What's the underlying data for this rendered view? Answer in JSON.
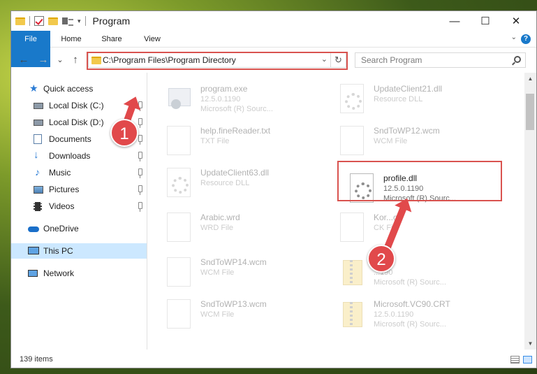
{
  "window": {
    "title": "Program",
    "controls": {
      "minimize": "—",
      "maximize": "☐",
      "close": "✕"
    }
  },
  "ribbon": {
    "tabs": [
      "File",
      "Home",
      "Share",
      "View"
    ],
    "help": "?",
    "toggle": "⌄"
  },
  "nav": {
    "back": "←",
    "forward": "→",
    "recent": "⌄",
    "up": "↑",
    "address": "C:\\Program Files\\Program Directory",
    "address_drop": "⌄",
    "refresh": "↻",
    "search_placeholder": "Search Program"
  },
  "sidebar": {
    "items": [
      {
        "label": "Quick access",
        "icon": "star-icon"
      },
      {
        "label": "Local Disk (C:)",
        "icon": "drive-icon"
      },
      {
        "label": "Local Disk (D:)",
        "icon": "drive-icon"
      },
      {
        "label": "Documents",
        "icon": "documents-icon"
      },
      {
        "label": "Downloads",
        "icon": "download-icon"
      },
      {
        "label": "Music",
        "icon": "music-icon"
      },
      {
        "label": "Pictures",
        "icon": "pictures-icon"
      },
      {
        "label": "Videos",
        "icon": "videos-icon"
      },
      {
        "label": "OneDrive",
        "icon": "cloud-icon"
      },
      {
        "label": "This PC",
        "icon": "computer-icon"
      },
      {
        "label": "Network",
        "icon": "network-icon"
      }
    ]
  },
  "files": [
    {
      "name": "program.exe",
      "line2": "12.5.0.1190",
      "line3": "Microsoft (R) Sourc...",
      "icon": "exe"
    },
    {
      "name": "UpdateClient21.dll",
      "line2": "Resource DLL",
      "line3": "",
      "icon": "gear"
    },
    {
      "name": "help.fineReader.txt",
      "line2": "TXT File",
      "line3": "",
      "icon": "doc"
    },
    {
      "name": "SndToWP12.wcm",
      "line2": "WCM File",
      "line3": "",
      "icon": "doc"
    },
    {
      "name": "UpdateClient63.dll",
      "line2": "Resource DLL",
      "line3": "",
      "icon": "gear"
    },
    {
      "name": "profile.dll",
      "line2": "12.5.0.1190",
      "line3": "Microsoft (R) Sourc...",
      "icon": "gear"
    },
    {
      "name": "Arabic.wrd",
      "line2": "WRD File",
      "line3": "",
      "icon": "doc"
    },
    {
      "name": "Kor...ck",
      "line2": "CK File",
      "line3": "",
      "icon": "doc"
    },
    {
      "name": "SndToWP14.wcm",
      "line2": "WCM File",
      "line3": "",
      "icon": "doc"
    },
    {
      "name": "",
      "line2": "...190",
      "line3": "Microsoft (R) Sourc...",
      "icon": "zip"
    },
    {
      "name": "SndToWP13.wcm",
      "line2": "WCM File",
      "line3": "",
      "icon": "doc"
    },
    {
      "name": "Microsoft.VC90.CRT",
      "line2": "12.5.0.1190",
      "line3": "Microsoft (R) Sourc...",
      "icon": "zip"
    }
  ],
  "status": {
    "items": "139 items"
  },
  "annotations": {
    "step1": "1",
    "step2": "2"
  },
  "colors": {
    "accent": "#1979ca",
    "highlight": "#d9534f",
    "arrow": "#e1494b",
    "selection": "#cce8ff"
  }
}
